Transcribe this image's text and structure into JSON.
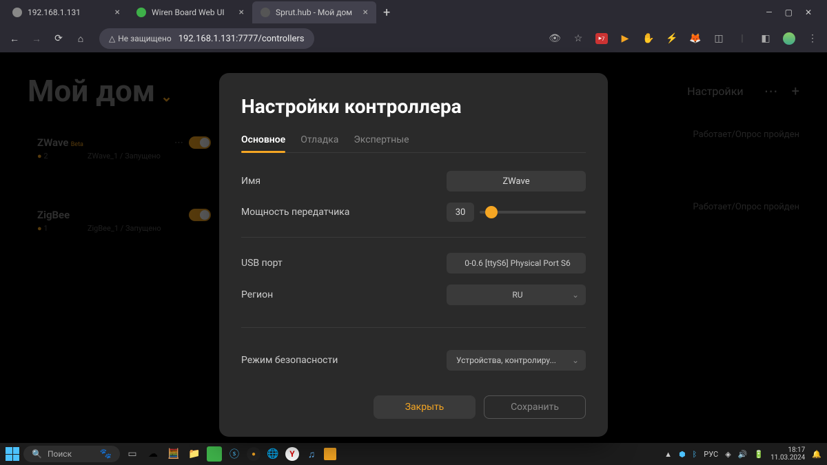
{
  "browser": {
    "tabs": [
      {
        "label": "192.168.1.131",
        "icon_bg": "#888"
      },
      {
        "label": "Wiren Board Web UI",
        "icon_bg": "#3eb049"
      },
      {
        "label": "Sprut.hub - Мой дом",
        "icon_bg": "#555",
        "active": true
      }
    ],
    "not_secure": "Не защищено",
    "url": "192.168.1.131:7777/controllers",
    "ext_badge": "7"
  },
  "page": {
    "title": "Мой дом",
    "settings_label": "Настройки",
    "controllers": [
      {
        "name": "ZWave",
        "badge": "Beta",
        "count": "2",
        "sub": "ZWave_1 / Запущено",
        "status": "Работает/Опрос пройден"
      },
      {
        "name": "ZigBee",
        "badge": "",
        "count": "1",
        "sub": "ZigBee_1 / Запущено",
        "status": "Работает/Опрос пройден"
      }
    ]
  },
  "modal": {
    "title": "Настройки контроллера",
    "tabs": [
      "Основное",
      "Отладка",
      "Экспертные"
    ],
    "fields": {
      "name_label": "Имя",
      "name_value": "ZWave",
      "power_label": "Мощность передатчика",
      "power_value": "30",
      "usb_label": "USB порт",
      "usb_value": "0-0.6 [ttyS6] Physical Port S6",
      "region_label": "Регион",
      "region_value": "RU",
      "security_label": "Режим безопасности",
      "security_value": "Устройства, контролиру..."
    },
    "buttons": {
      "close": "Закрыть",
      "save": "Сохранить"
    }
  },
  "taskbar": {
    "search_placeholder": "Поиск",
    "lang": "РУС",
    "time": "18:17",
    "date": "11.03.2024"
  }
}
